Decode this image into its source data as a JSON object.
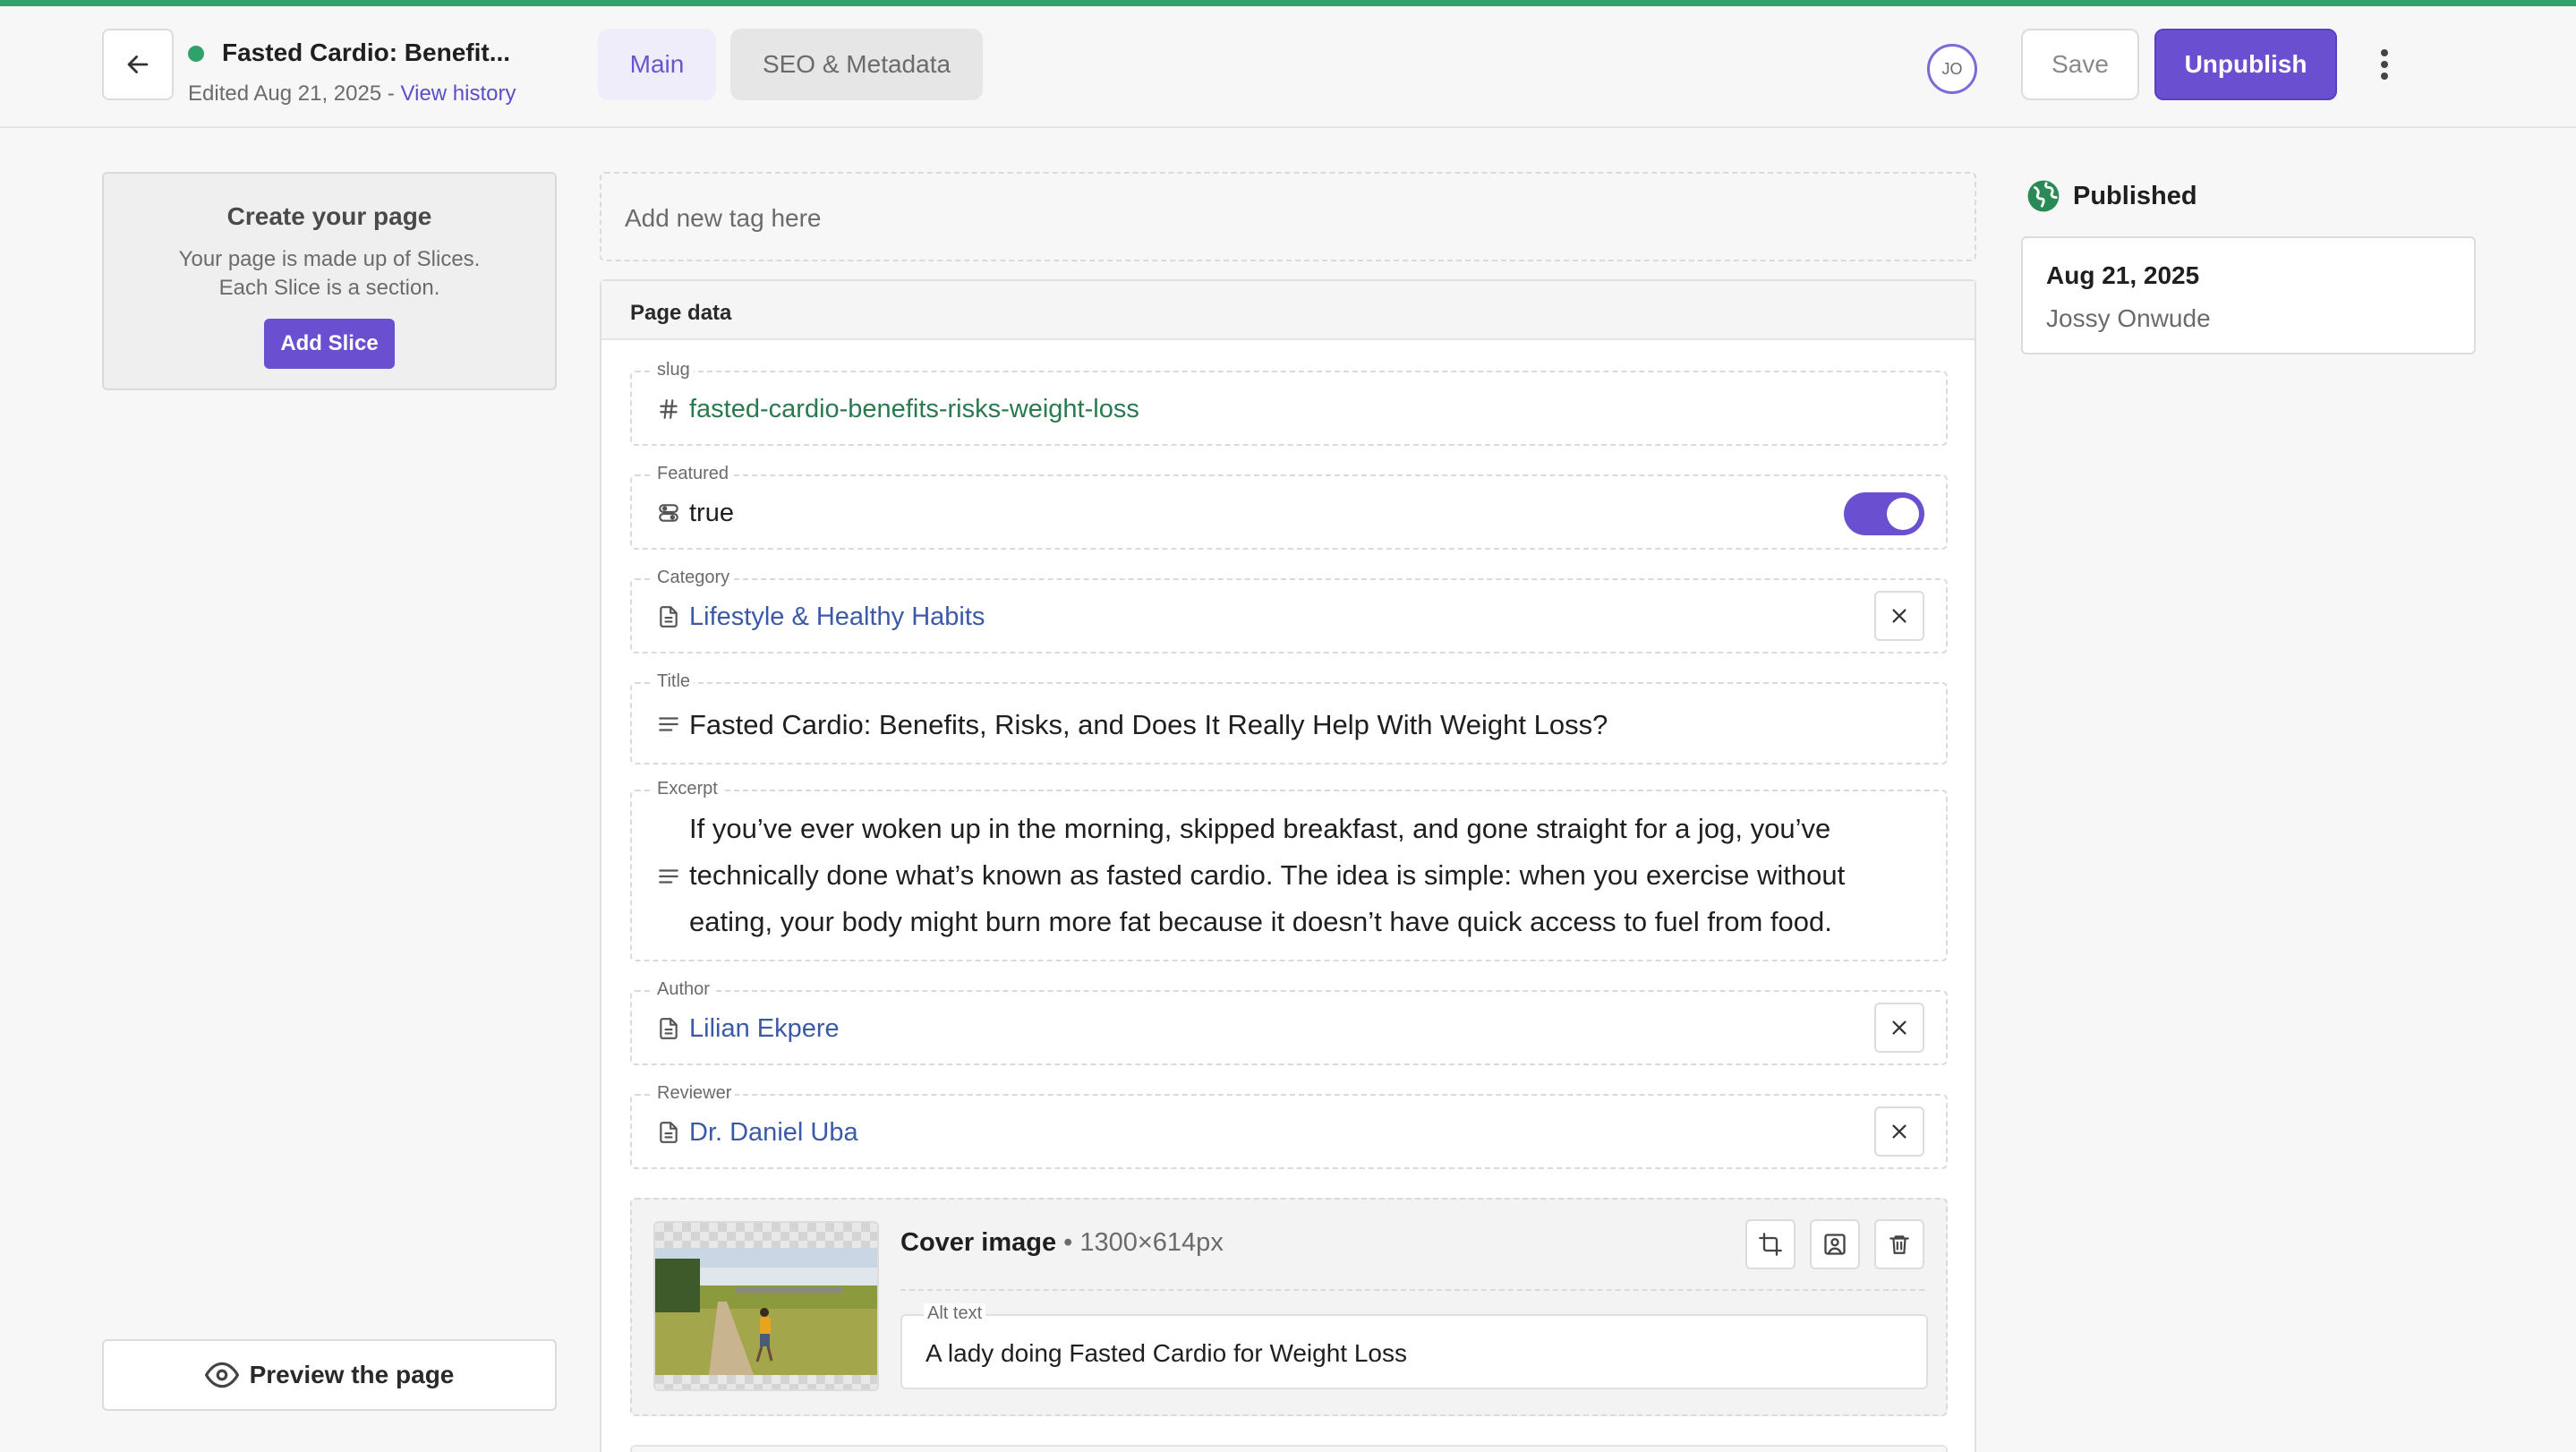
{
  "header": {
    "title": "Fasted Cardio: Benefit...",
    "edited": "Edited Aug 21, 2025 -",
    "view_history": "View history",
    "tabs": [
      {
        "label": "Main"
      },
      {
        "label": "SEO & Metadata"
      }
    ],
    "avatar_initials": "JO",
    "save_label": "Save",
    "unpublish_label": "Unpublish"
  },
  "sidebar": {
    "card_title": "Create your page",
    "card_line1": "Your page is made up of Slices.",
    "card_line2": "Each Slice is a section.",
    "add_slice": "Add Slice",
    "preview": "Preview the page"
  },
  "tags": {
    "placeholder": "Add new tag here"
  },
  "page_data": {
    "heading": "Page data",
    "slug_label": "slug",
    "slug_value": "fasted-cardio-benefits-risks-weight-loss",
    "featured_label": "Featured",
    "featured_value": "true",
    "category_label": "Category",
    "category_value": "Lifestyle & Healthy Habits",
    "title_label": "Title",
    "title_value": "Fasted Cardio: Benefits, Risks, and Does It Really Help With Weight Loss?",
    "excerpt_label": "Excerpt",
    "excerpt_value": "If you’ve ever woken up in the morning, skipped breakfast, and gone straight for a jog, you’ve technically done what’s known as fasted cardio. The idea is simple: when you exercise without eating, your body might burn more fat because it doesn’t have quick access to fuel from food.",
    "author_label": "Author",
    "author_value": "Lilian Ekpere",
    "reviewer_label": "Reviewer",
    "reviewer_value": "Dr. Daniel Uba",
    "cover_label": "Cover image",
    "cover_dims": "• 1300×614px",
    "alt_label": "Alt text",
    "alt_value": "A lady doing Fasted Cardio for Weight Loss"
  },
  "status": {
    "label": "Published",
    "date": "Aug 21, 2025",
    "user": "Jossy Onwude"
  },
  "colors": {
    "accent": "#6a4fd0",
    "published_green": "#2fa36b"
  },
  "icons": [
    "back-arrow-icon",
    "kebab-menu-icon",
    "eye-icon",
    "globe-icon",
    "hash-icon",
    "toggle-icon",
    "document-icon",
    "text-lines-icon",
    "close-icon",
    "crop-icon",
    "replace-image-icon",
    "trash-icon"
  ]
}
